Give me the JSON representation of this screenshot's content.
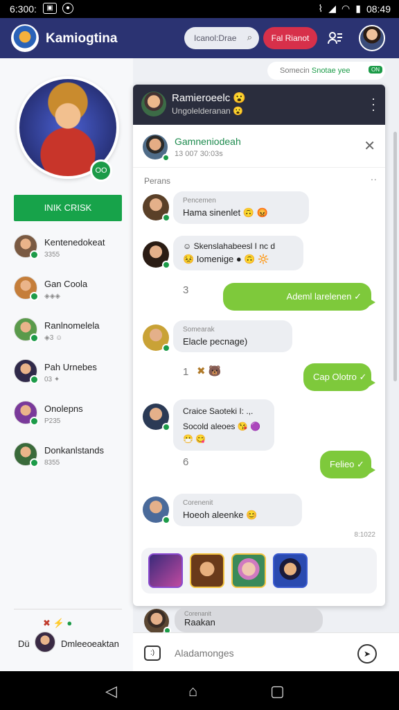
{
  "status_bar": {
    "time": "6:300:",
    "right_time": "08:49",
    "icons": [
      "image-icon",
      "notification-icon",
      "signal-icon",
      "wifi-icon",
      "battery-icon"
    ]
  },
  "app_bar": {
    "title": "Kamiogtina",
    "search_placeholder": "Icanol:Drae",
    "action_label": "Fal Rianot"
  },
  "left": {
    "badge": "ОО",
    "primary_button": "INIK CRISK",
    "friends": [
      {
        "name": "Kentenedokeat",
        "sub": "3355",
        "color": "#7a5a42"
      },
      {
        "name": "Gan Coola",
        "sub": "◈◈◈",
        "color": "#c57e3a"
      },
      {
        "name": "Ranlnomelela",
        "sub": "◈3 ☺",
        "color": "#5a9a4b"
      },
      {
        "name": "Pah Urnebes",
        "sub": "03 ✦",
        "color": "#302a4a"
      },
      {
        "name": "Onolepns",
        "sub": "P235",
        "color": "#7a3a9a"
      },
      {
        "name": "Donkanlstands",
        "sub": "8355",
        "color": "#3a6a3a"
      }
    ],
    "bottom_du": "Dü",
    "bottom_name": "Dmleeoeaktan"
  },
  "online_chip": {
    "text": "Somecin ",
    "highlight": "Snotae yee",
    "tag": "ON"
  },
  "chat": {
    "header_name": "Ramieroeelc 😮",
    "header_status": "Ungolelderanan 😮",
    "sub_name": "Gamneniodeah",
    "sub_meta": "13 007 30:03s",
    "section_label": "Perans",
    "messages": [
      {
        "small": "Pencemen",
        "text": "Hama sinenlet 🙃 😡"
      },
      {
        "small": "☺ Skenslahabeesl I nc d",
        "text": "😣 Iomenige ● 🙃 🔆"
      },
      {
        "small": "Somearak",
        "text": "Elacle pecnage)"
      },
      {
        "small": "Craice Saoteki I: .,.",
        "text": "Socold aleoes 😘 🟣 😷 😋"
      },
      {
        "small": "Corenenit",
        "text": "Hoeoh aleenke 😊"
      }
    ],
    "outgoing": [
      {
        "text": "Ademl larelenen ✓"
      },
      {
        "text": "Cap Olotro ✓"
      },
      {
        "text": "Felieo ✓"
      }
    ],
    "side_numbers": [
      "3",
      "1",
      "6"
    ],
    "side_emojis": "✖ 🐻",
    "timestamp": "8:1022",
    "peek_small": "Corenanit",
    "peek_text": "Raakan",
    "composer_placeholder": "Aladamonges"
  }
}
